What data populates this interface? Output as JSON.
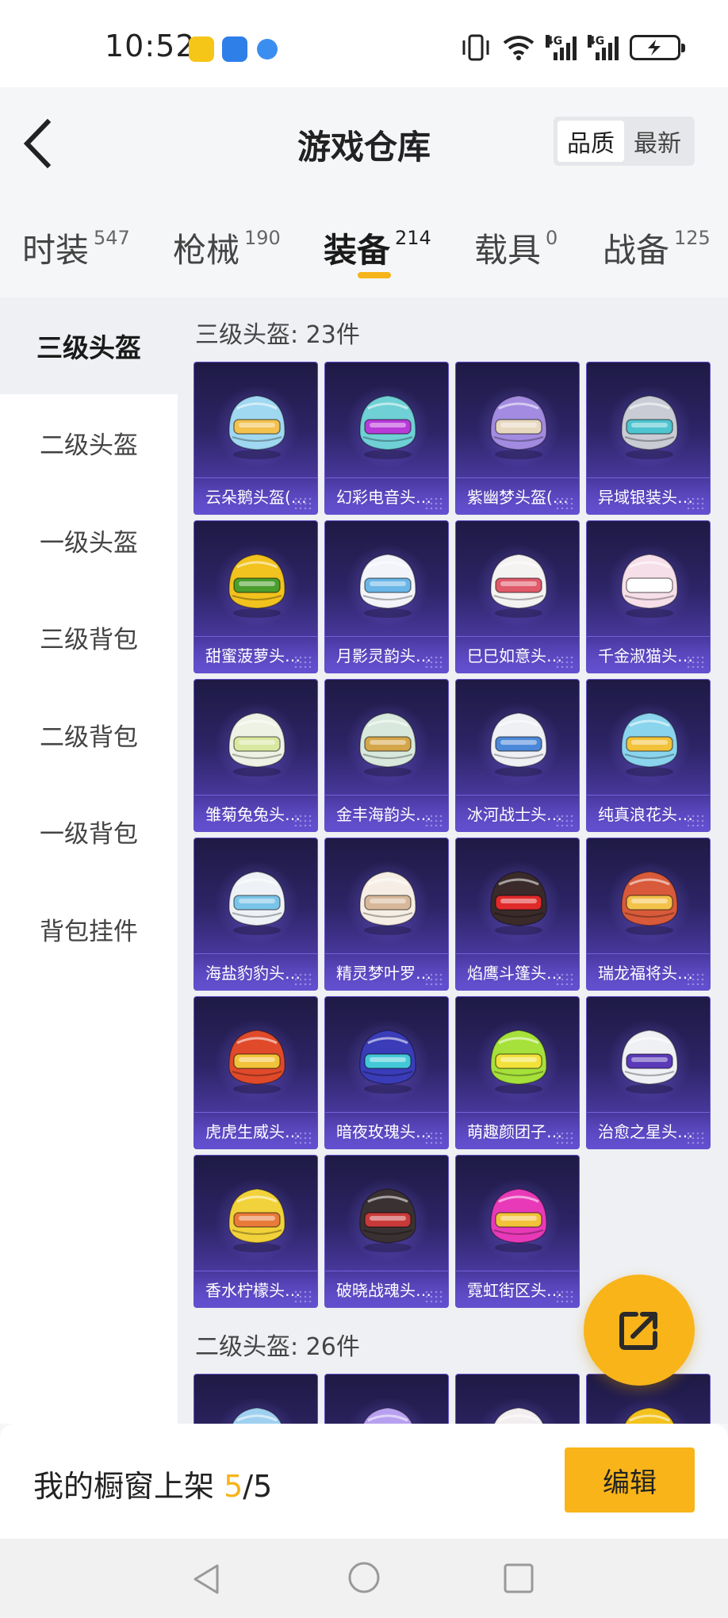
{
  "status_bar": {
    "time": "10:52",
    "signal1_label": "4G",
    "signal2_label": "4G"
  },
  "header": {
    "title": "游戏仓库",
    "sort_options": [
      "品质",
      "最新"
    ],
    "active_sort": "品质"
  },
  "category_tabs": [
    {
      "label": "时装",
      "count": "547"
    },
    {
      "label": "枪械",
      "count": "190"
    },
    {
      "label": "装备",
      "count": "214"
    },
    {
      "label": "载具",
      "count": "0"
    },
    {
      "label": "战备",
      "count": "125"
    }
  ],
  "active_category": "装备",
  "sidebar": [
    "三级头盔",
    "二级头盔",
    "一级头盔",
    "三级背包",
    "二级背包",
    "一级背包",
    "背包挂件"
  ],
  "sections": [
    {
      "title": "三级头盔: 23件",
      "items": [
        {
          "name": "云朵鹅头盔(…",
          "colors": [
            "#9fd8f0",
            "#f2c14e"
          ]
        },
        {
          "name": "幻彩电音头…",
          "colors": [
            "#6fd0d6",
            "#b83ad8"
          ]
        },
        {
          "name": "紫幽梦头盔(…",
          "colors": [
            "#a28be0",
            "#e8d8c0"
          ]
        },
        {
          "name": "异域银装头…",
          "colors": [
            "#c9ccd4",
            "#4ec4d0"
          ]
        },
        {
          "name": "甜蜜菠萝头…",
          "colors": [
            "#f2c21e",
            "#4b9e2c"
          ]
        },
        {
          "name": "月影灵韵头…",
          "colors": [
            "#f2f4fa",
            "#6ab6e6"
          ]
        },
        {
          "name": "巳巳如意头…",
          "colors": [
            "#f5f2f2",
            "#e05a6a"
          ]
        },
        {
          "name": "千金淑猫头…",
          "colors": [
            "#f6dfe8",
            "#ffffff"
          ]
        },
        {
          "name": "雏菊兔兔头…",
          "colors": [
            "#eef2e4",
            "#d8e8a0"
          ]
        },
        {
          "name": "金丰海韵头…",
          "colors": [
            "#d8e8dc",
            "#d4a64a"
          ]
        },
        {
          "name": "冰河战士头…",
          "colors": [
            "#eef0f4",
            "#4c88d8"
          ]
        },
        {
          "name": "纯真浪花头…",
          "colors": [
            "#8ad4ee",
            "#f2c23a"
          ]
        },
        {
          "name": "海盐豹豹头…",
          "colors": [
            "#eef2f6",
            "#7ac4e8"
          ]
        },
        {
          "name": "精灵梦叶罗…",
          "colors": [
            "#f6eee4",
            "#d8b89a"
          ]
        },
        {
          "name": "焰鹰斗篷头…",
          "colors": [
            "#3a2a2a",
            "#e02a2a"
          ]
        },
        {
          "name": "瑞龙福将头…",
          "colors": [
            "#d85a3a",
            "#f2c24a"
          ]
        },
        {
          "name": "虎虎生威头…",
          "colors": [
            "#e04a2a",
            "#f2c23a"
          ]
        },
        {
          "name": "暗夜玫瑰头…",
          "colors": [
            "#3a3cb8",
            "#44c8d8"
          ]
        },
        {
          "name": "萌趣颜团子…",
          "colors": [
            "#a6e03a",
            "#f2e23a"
          ]
        },
        {
          "name": "治愈之星头…",
          "colors": [
            "#eef0f4",
            "#5a3ab8"
          ]
        },
        {
          "name": "香水柠檬头…",
          "colors": [
            "#f2d23a",
            "#e87a3a"
          ]
        },
        {
          "name": "破晓战魂头…",
          "colors": [
            "#3a3232",
            "#c83a3a"
          ]
        },
        {
          "name": "霓虹街区头…",
          "colors": [
            "#e83ab8",
            "#f2c23a"
          ]
        }
      ]
    },
    {
      "title": "二级头盔: 26件",
      "items": [
        {
          "name": "",
          "colors": [
            "#9fd0f0",
            "#f2c14e"
          ]
        },
        {
          "name": "",
          "colors": [
            "#b8a0f0",
            "#eef0f4"
          ]
        },
        {
          "name": "",
          "colors": [
            "#f2eef0",
            "#d4a64a"
          ]
        },
        {
          "name": "",
          "colors": [
            "#f2c21e",
            "#4b9e2c"
          ]
        }
      ]
    }
  ],
  "showcase": {
    "label": "我的橱窗上架 ",
    "current": "5",
    "total": "/5",
    "edit_label": "编辑"
  }
}
